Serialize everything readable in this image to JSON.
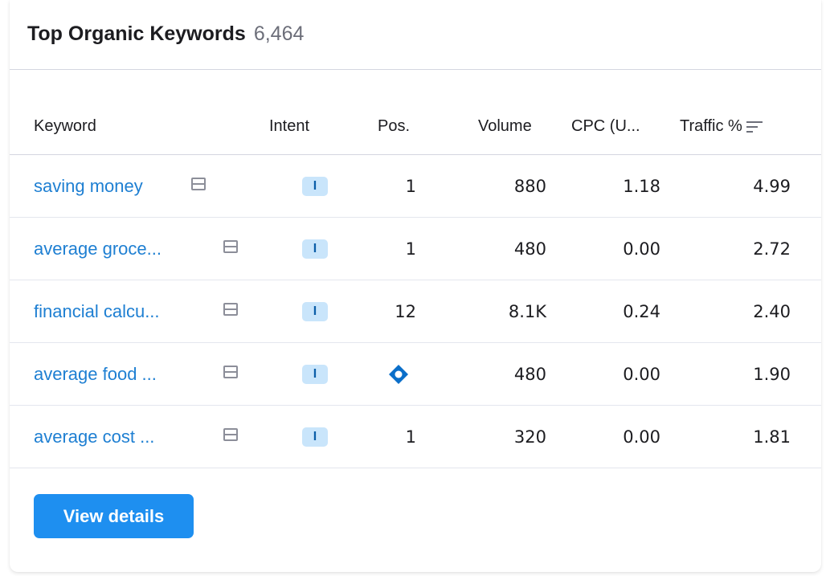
{
  "widget": {
    "title": "Top Organic Keywords",
    "count": "6,464"
  },
  "columns": {
    "keyword": "Keyword",
    "intent": "Intent",
    "pos": "Pos.",
    "volume": "Volume",
    "cpc": "CPC (U...",
    "traffic": "Traffic %"
  },
  "rows": [
    {
      "keyword": "saving money",
      "intent": "I",
      "pos": "1",
      "volume": "880",
      "cpc": "1.18",
      "traffic": "4.99"
    },
    {
      "keyword": "average groce...",
      "intent": "I",
      "pos": "1",
      "volume": "480",
      "cpc": "0.00",
      "traffic": "2.72"
    },
    {
      "keyword": "financial calcu...",
      "intent": "I",
      "pos": "12",
      "volume": "8.1K",
      "cpc": "0.24",
      "traffic": "2.40"
    },
    {
      "keyword": "average food ...",
      "intent": "I",
      "pos": "",
      "pos_icon": "serp-feature-icon",
      "volume": "480",
      "cpc": "0.00",
      "traffic": "1.90"
    },
    {
      "keyword": "average cost ...",
      "intent": "I",
      "pos": "1",
      "volume": "320",
      "cpc": "0.00",
      "traffic": "1.81"
    }
  ],
  "actions": {
    "view_details": "View details"
  },
  "icons": {
    "serp": "serp-snapshot-icon",
    "sort": "sort-descending-icon",
    "feature": "serp-feature-icon"
  },
  "colors": {
    "link": "#1e7fd2",
    "accent": "#1e8ff0",
    "intent_bg": "#c9e5fb",
    "intent_text": "#0b5ea8"
  }
}
